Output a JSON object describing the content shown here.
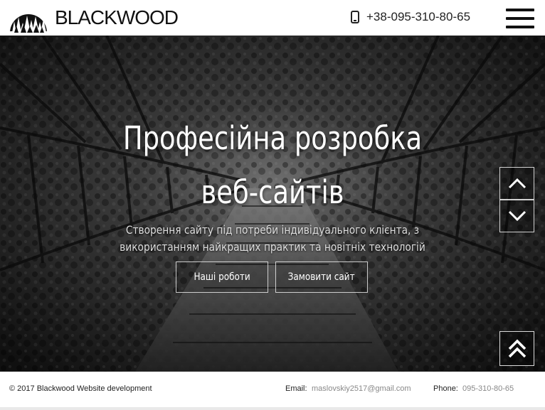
{
  "header": {
    "brand": "BLACKWOOD",
    "phone": "+38-095-310-80-65",
    "icons": {
      "logo": "forest-logo-icon",
      "phone": "smartphone-icon",
      "menu": "hamburger-menu-icon"
    }
  },
  "hero": {
    "title_line1": "Професійна розробка",
    "title_line2": "веб-сайтів",
    "subtitle_line1": "Створення сайту під потреби індивідуального клієнта, з",
    "subtitle_line2": "використанням найкращих практик та новітніх технологій",
    "button_portfolio": "Наші роботи",
    "button_order": "Замовити сайт",
    "icons": {
      "up": "chevron-up-icon",
      "down": "chevron-down-icon",
      "to_top": "double-chevron-up-icon"
    }
  },
  "footer": {
    "copyright": "© 2017 Blackwood Website development",
    "email_label": "Email:",
    "email": "maslovskiy2517@gmail.com",
    "phone_label": "Phone:",
    "phone": "095-310-80-65"
  },
  "colors": {
    "text_dark": "#111111",
    "text_muted": "#888888",
    "hero_overlay": "#1b1b1b",
    "white": "#ffffff"
  }
}
